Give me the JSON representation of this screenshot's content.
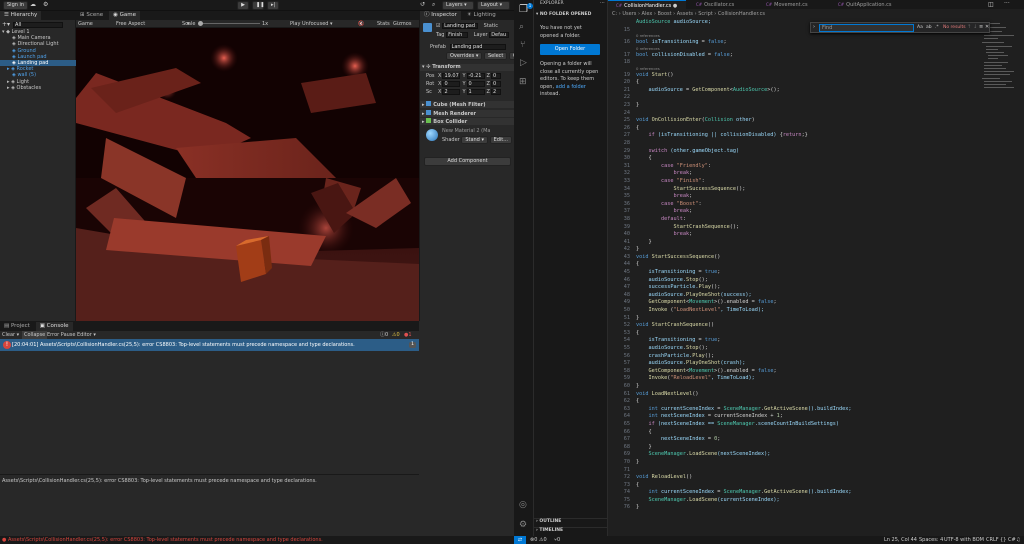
{
  "unity": {
    "toolbar": {
      "sign_in": "Sign in",
      "layers": "Layers",
      "layout": "Layout"
    },
    "hierarchy": {
      "tab": "Hierarchy",
      "search_placeholder": "All",
      "items": [
        {
          "label": "Level 1",
          "indent": 0,
          "style": "root"
        },
        {
          "label": "Main Camera",
          "indent": 2,
          "style": "normal"
        },
        {
          "label": "Directional Light",
          "indent": 2,
          "style": "normal"
        },
        {
          "label": "Ground",
          "indent": 2,
          "style": "blue"
        },
        {
          "label": "Launch pad",
          "indent": 2,
          "style": "blue"
        },
        {
          "label": "Landing pad",
          "indent": 2,
          "style": "selected"
        },
        {
          "label": "Rocket",
          "indent": 1,
          "style": "blue"
        },
        {
          "label": "wall (5)",
          "indent": 2,
          "style": "blue"
        },
        {
          "label": "Light",
          "indent": 1,
          "style": "normal"
        },
        {
          "label": "Obstacles",
          "indent": 1,
          "style": "normal"
        }
      ]
    },
    "scene": {
      "tabs": [
        "Scene",
        "Game"
      ],
      "active_tab": "Game",
      "display": "Game",
      "aspect": "Free Aspect",
      "scale_label": "Scale",
      "scale_value": "1x",
      "play_mode": "Play Unfocused",
      "stats": "Stats",
      "gizmos": "Gizmos"
    },
    "inspector": {
      "tabs": [
        "Inspector",
        "Lighting"
      ],
      "object_name": "Landing pad",
      "static_label": "Static",
      "tag_label": "Tag",
      "tag_value": "Finish",
      "layer_label": "Layer",
      "layer_value": "Defau",
      "prefab_label": "Prefab",
      "prefab_value": "Landing pad",
      "overrides": "Overrides",
      "select": "Select",
      "open": "Open",
      "transform": {
        "title": "Transform",
        "rows": [
          {
            "label": "Pos",
            "x": "19.07",
            "y": "-0.21",
            "z": "0"
          },
          {
            "label": "Rot",
            "x": "0",
            "y": "0",
            "z": "0"
          },
          {
            "label": "Sc",
            "x": "2",
            "y": "1",
            "z": "2"
          }
        ]
      },
      "components": [
        {
          "label": "Cube (Mesh Filter)"
        },
        {
          "label": "Mesh Renderer"
        },
        {
          "label": "Box Collider"
        }
      ],
      "material_name": "New Material 2 (Ma",
      "shader_label": "Shader",
      "shader_value": "Stand",
      "edit": "Edit...",
      "add_component": "Add Component"
    },
    "console": {
      "tabs": [
        "Project",
        "Console"
      ],
      "active_tab": "Console",
      "clear": "Clear",
      "collapse": "Collapse",
      "error_pause": "Error Pause",
      "editor": "Editor",
      "count_info": "0",
      "count_warn": "0",
      "count_error": "1",
      "error_line": "[20:04:01] Assets\\Scripts\\CollisionHandler.cs(25,5): error CS8803: Top-level statements must precede namespace and type declarations.",
      "error_count_badge": "1",
      "detail": "Assets\\Scripts\\CollisionHandler.cs(25,5): error CS8803: Top-level statements must precede namespace and type declarations."
    },
    "status_error": "Assets\\Scripts\\CollisionHandler.cs(25,5): error CS8803: Top-level statements must precede namespace and type declarations."
  },
  "vscode": {
    "explorer": {
      "title": "EXPLORER",
      "no_folder": "NO FOLDER OPENED",
      "msg1": "You have not yet opened a folder.",
      "open_folder": "Open Folder",
      "msg2_a": "Opening a folder will close all currently open editors. To keep them open,",
      "msg2_link": "add a folder",
      "msg2_b": "instead.",
      "outline": "OUTLINE",
      "timeline": "TIMELINE"
    },
    "tabs": [
      {
        "label": "CollisionHandler.cs",
        "active": true
      },
      {
        "label": "Oscillator.cs",
        "active": false
      },
      {
        "label": "Movement.cs",
        "active": false
      },
      {
        "label": "QuitApplication.cs",
        "active": false
      }
    ],
    "breadcrumb": "C: › Users › Alex › Boost › Assets › Script › CollisionHandler.cs",
    "find": {
      "placeholder": "Find",
      "result": "No results"
    },
    "status": {
      "errors": "0",
      "warnings": "0",
      "ports": "0",
      "position": "Ln 25, Col 44",
      "spaces": "Spaces: 4",
      "encoding": "UTF-8 with BOM",
      "eol": "CRLF",
      "language": "C#"
    },
    "code": [
      {
        "n": "",
        "t": [
          [
            "AudioSource ",
            "ty"
          ],
          [
            "audioSource;",
            "id"
          ]
        ]
      },
      {
        "n": "15",
        "t": []
      },
      {
        "ref": "0 references"
      },
      {
        "n": "16",
        "t": [
          [
            "bool ",
            "kw"
          ],
          [
            "isTransitioning ",
            "id"
          ],
          [
            "= ",
            "pl"
          ],
          [
            "false",
            "kw"
          ],
          [
            ";",
            "pl"
          ]
        ]
      },
      {
        "ref": "0 references"
      },
      {
        "n": "17",
        "t": [
          [
            "bool ",
            "kw"
          ],
          [
            "collisionDisabled ",
            "id"
          ],
          [
            "= ",
            "pl"
          ],
          [
            "false",
            "kw"
          ],
          [
            ";",
            "pl"
          ]
        ]
      },
      {
        "n": "18",
        "t": []
      },
      {
        "ref": "0 references"
      },
      {
        "n": "19",
        "t": [
          [
            "void ",
            "kw"
          ],
          [
            "Start",
            "fn"
          ],
          [
            "()",
            "pl"
          ]
        ]
      },
      {
        "n": "20",
        "t": [
          [
            "{",
            "pl"
          ]
        ]
      },
      {
        "n": "21",
        "t": [
          [
            "    audioSource ",
            "id"
          ],
          [
            "= ",
            "pl"
          ],
          [
            "GetComponent",
            "fn"
          ],
          [
            "<",
            "pl"
          ],
          [
            "AudioSource",
            "ty"
          ],
          [
            ">();",
            "pl"
          ]
        ]
      },
      {
        "n": "22",
        "t": []
      },
      {
        "n": "23",
        "t": [
          [
            "}",
            "pl"
          ]
        ]
      },
      {
        "n": "24",
        "t": []
      },
      {
        "n": "25",
        "t": [
          [
            "void ",
            "kw"
          ],
          [
            "OnCollisionEnter",
            "fn"
          ],
          [
            "(",
            "pl"
          ],
          [
            "Collision ",
            "ty"
          ],
          [
            "other",
            "id"
          ],
          [
            ")",
            "pl"
          ]
        ]
      },
      {
        "n": "26",
        "t": [
          [
            "{",
            "pl"
          ]
        ]
      },
      {
        "n": "27",
        "t": [
          [
            "    if ",
            "ctl"
          ],
          [
            "(isTransitioning || collisionDisabled) ",
            "id"
          ],
          [
            "{",
            "pl"
          ],
          [
            "return",
            "ctl"
          ],
          [
            ";}",
            "pl"
          ]
        ]
      },
      {
        "n": "28",
        "t": []
      },
      {
        "n": "29",
        "t": [
          [
            "    switch ",
            "ctl"
          ],
          [
            "(other.gameObject.tag)",
            "id"
          ]
        ]
      },
      {
        "n": "30",
        "t": [
          [
            "    {",
            "pl"
          ]
        ]
      },
      {
        "n": "31",
        "t": [
          [
            "        case ",
            "ctl"
          ],
          [
            "\"Friendly\"",
            "st"
          ],
          [
            ":",
            "pl"
          ]
        ]
      },
      {
        "n": "32",
        "t": [
          [
            "            break",
            "ctl"
          ],
          [
            ";",
            "pl"
          ]
        ]
      },
      {
        "n": "33",
        "t": [
          [
            "        case ",
            "ctl"
          ],
          [
            "\"Finish\"",
            "st"
          ],
          [
            ":",
            "pl"
          ]
        ]
      },
      {
        "n": "34",
        "t": [
          [
            "            StartSuccessSequence",
            "fn"
          ],
          [
            "();",
            "pl"
          ]
        ]
      },
      {
        "n": "35",
        "t": [
          [
            "            break",
            "ctl"
          ],
          [
            ";",
            "pl"
          ]
        ]
      },
      {
        "n": "36",
        "t": [
          [
            "        case ",
            "ctl"
          ],
          [
            "\"Boost\"",
            "st"
          ],
          [
            ":",
            "pl"
          ]
        ]
      },
      {
        "n": "37",
        "t": [
          [
            "            break",
            "ctl"
          ],
          [
            ";",
            "pl"
          ]
        ]
      },
      {
        "n": "38",
        "t": [
          [
            "        default",
            "ctl"
          ],
          [
            ":",
            "pl"
          ]
        ]
      },
      {
        "n": "39",
        "t": [
          [
            "            StartCrashSequence",
            "fn"
          ],
          [
            "();",
            "pl"
          ]
        ]
      },
      {
        "n": "40",
        "t": [
          [
            "            break",
            "ctl"
          ],
          [
            ";",
            "pl"
          ]
        ]
      },
      {
        "n": "41",
        "t": [
          [
            "    }",
            "pl"
          ]
        ]
      },
      {
        "n": "42",
        "t": [
          [
            "}",
            "pl"
          ]
        ]
      },
      {
        "n": "43",
        "t": [
          [
            "void ",
            "kw"
          ],
          [
            "StartSuccessSequence",
            "fn"
          ],
          [
            "()",
            "pl"
          ]
        ]
      },
      {
        "n": "44",
        "t": [
          [
            "{",
            "pl"
          ]
        ]
      },
      {
        "n": "45",
        "t": [
          [
            "    isTransitioning ",
            "id"
          ],
          [
            "= ",
            "pl"
          ],
          [
            "true",
            "kw"
          ],
          [
            ";",
            "pl"
          ]
        ]
      },
      {
        "n": "46",
        "t": [
          [
            "    audioSource.",
            "id"
          ],
          [
            "Stop",
            "fn"
          ],
          [
            "();",
            "pl"
          ]
        ]
      },
      {
        "n": "47",
        "t": [
          [
            "    successParticle.",
            "id"
          ],
          [
            "Play",
            "fn"
          ],
          [
            "();",
            "pl"
          ]
        ]
      },
      {
        "n": "48",
        "t": [
          [
            "    audioSource.",
            "id"
          ],
          [
            "PlayOneShot",
            "fn"
          ],
          [
            "(success);",
            "id"
          ]
        ]
      },
      {
        "n": "49",
        "t": [
          [
            "    GetComponent",
            "fn"
          ],
          [
            "<",
            "pl"
          ],
          [
            "Movement",
            "ty"
          ],
          [
            ">().enabled = ",
            "pl"
          ],
          [
            "false",
            "kw"
          ],
          [
            ";",
            "pl"
          ]
        ]
      },
      {
        "n": "50",
        "t": [
          [
            "    Invoke ",
            "fn"
          ],
          [
            "(",
            "pl"
          ],
          [
            "\"LoadNextLevel\"",
            "st"
          ],
          [
            ", TimeToLoad);",
            "id"
          ]
        ]
      },
      {
        "n": "51",
        "t": [
          [
            "}",
            "pl"
          ]
        ]
      },
      {
        "n": "52",
        "t": [
          [
            "void ",
            "kw"
          ],
          [
            "StartCrashSequence",
            "fn"
          ],
          [
            "()",
            "pl"
          ]
        ]
      },
      {
        "n": "53",
        "t": [
          [
            "{",
            "pl"
          ]
        ]
      },
      {
        "n": "54",
        "t": [
          [
            "    isTransitioning ",
            "id"
          ],
          [
            "= ",
            "pl"
          ],
          [
            "true",
            "kw"
          ],
          [
            ";",
            "pl"
          ]
        ]
      },
      {
        "n": "55",
        "t": [
          [
            "    audioSource.",
            "id"
          ],
          [
            "Stop",
            "fn"
          ],
          [
            "();",
            "pl"
          ]
        ]
      },
      {
        "n": "56",
        "t": [
          [
            "    crashParticle.",
            "id"
          ],
          [
            "Play",
            "fn"
          ],
          [
            "();",
            "pl"
          ]
        ]
      },
      {
        "n": "57",
        "t": [
          [
            "    audioSource.",
            "id"
          ],
          [
            "PlayOneShot",
            "fn"
          ],
          [
            "(crash);",
            "id"
          ]
        ]
      },
      {
        "n": "58",
        "t": [
          [
            "    GetComponent",
            "fn"
          ],
          [
            "<",
            "pl"
          ],
          [
            "Movement",
            "ty"
          ],
          [
            ">().enabled = ",
            "pl"
          ],
          [
            "false",
            "kw"
          ],
          [
            ";",
            "pl"
          ]
        ]
      },
      {
        "n": "59",
        "t": [
          [
            "    Invoke",
            "fn"
          ],
          [
            "(",
            "pl"
          ],
          [
            "\"ReloadLevel\"",
            "st"
          ],
          [
            ", TimeToLoad);",
            "id"
          ]
        ]
      },
      {
        "n": "60",
        "t": [
          [
            "}",
            "pl"
          ]
        ]
      },
      {
        "n": "61",
        "t": [
          [
            "void ",
            "kw"
          ],
          [
            "LoadNextLevel",
            "fn"
          ],
          [
            "()",
            "pl"
          ]
        ]
      },
      {
        "n": "62",
        "t": [
          [
            "{",
            "pl"
          ]
        ]
      },
      {
        "n": "63",
        "t": [
          [
            "    int ",
            "kw"
          ],
          [
            "currentSceneIndex ",
            "id"
          ],
          [
            "= ",
            "pl"
          ],
          [
            "SceneManager",
            "ty"
          ],
          [
            ".",
            "pl"
          ],
          [
            "GetActiveScene",
            "fn"
          ],
          [
            "().buildIndex;",
            "id"
          ]
        ]
      },
      {
        "n": "64",
        "t": [
          [
            "    int ",
            "kw"
          ],
          [
            "nextSceneIndex ",
            "id"
          ],
          [
            "= currentSceneIndex + ",
            "pl"
          ],
          [
            "1",
            "nm"
          ],
          [
            ";",
            "pl"
          ]
        ]
      },
      {
        "n": "65",
        "t": [
          [
            "    if ",
            "ctl"
          ],
          [
            "(nextSceneIndex == ",
            "id"
          ],
          [
            "SceneManager",
            "ty"
          ],
          [
            ".sceneCountInBuildSettings)",
            "id"
          ]
        ]
      },
      {
        "n": "66",
        "t": [
          [
            "    {",
            "pl"
          ]
        ]
      },
      {
        "n": "67",
        "t": [
          [
            "        nextSceneIndex ",
            "id"
          ],
          [
            "= ",
            "pl"
          ],
          [
            "0",
            "nm"
          ],
          [
            ";",
            "pl"
          ]
        ]
      },
      {
        "n": "68",
        "t": [
          [
            "    }",
            "pl"
          ]
        ]
      },
      {
        "n": "69",
        "t": [
          [
            "    SceneManager",
            "ty"
          ],
          [
            ".",
            "pl"
          ],
          [
            "LoadScene",
            "fn"
          ],
          [
            "(nextSceneIndex);",
            "id"
          ]
        ]
      },
      {
        "n": "70",
        "t": [
          [
            "}",
            "pl"
          ]
        ]
      },
      {
        "n": "71",
        "t": []
      },
      {
        "n": "72",
        "t": [
          [
            "void ",
            "kw"
          ],
          [
            "ReloadLevel",
            "fn"
          ],
          [
            "()",
            "pl"
          ]
        ]
      },
      {
        "n": "73",
        "t": [
          [
            "{",
            "pl"
          ]
        ]
      },
      {
        "n": "74",
        "t": [
          [
            "    int ",
            "kw"
          ],
          [
            "currentSceneIndex ",
            "id"
          ],
          [
            "= ",
            "pl"
          ],
          [
            "SceneManager",
            "ty"
          ],
          [
            ".",
            "pl"
          ],
          [
            "GetActiveScene",
            "fn"
          ],
          [
            "().buildIndex;",
            "id"
          ]
        ]
      },
      {
        "n": "75",
        "t": [
          [
            "    SceneManager",
            "ty"
          ],
          [
            ".",
            "pl"
          ],
          [
            "LoadScene",
            "fn"
          ],
          [
            "(currentSceneIndex);",
            "id"
          ]
        ]
      },
      {
        "n": "76",
        "t": [
          [
            "}",
            "pl"
          ]
        ]
      }
    ]
  }
}
